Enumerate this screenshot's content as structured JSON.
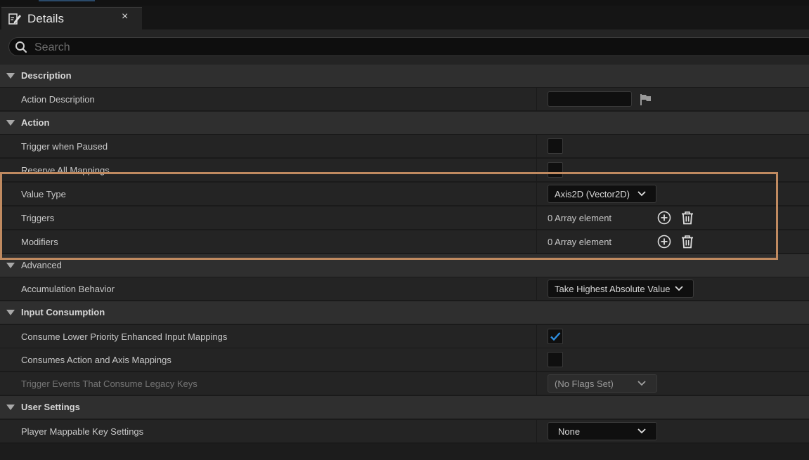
{
  "tab": {
    "title": "Details",
    "close": "×"
  },
  "search": {
    "placeholder": "Search",
    "value": ""
  },
  "sections": {
    "description": "Description",
    "action": "Action",
    "advanced": "Advanced",
    "input_consumption": "Input Consumption",
    "user_settings": "User Settings"
  },
  "props": {
    "action_description": {
      "label": "Action Description",
      "value": ""
    },
    "trigger_when_paused": {
      "label": "Trigger when Paused",
      "checked": false
    },
    "reserve_all_mappings": {
      "label": "Reserve All Mappings",
      "checked": false
    },
    "value_type": {
      "label": "Value Type",
      "value": "Axis2D (Vector2D)"
    },
    "triggers": {
      "label": "Triggers",
      "value": "0 Array element"
    },
    "modifiers": {
      "label": "Modifiers",
      "value": "0 Array element"
    },
    "accumulation_behavior": {
      "label": "Accumulation Behavior",
      "value": "Take Highest Absolute Value"
    },
    "consume_lower_priority": {
      "label": "Consume Lower Priority Enhanced Input Mappings",
      "checked": true
    },
    "consumes_action_axis": {
      "label": "Consumes Action and Axis Mappings",
      "checked": false
    },
    "trigger_events_legacy": {
      "label": "Trigger Events That Consume Legacy Keys",
      "value": "(No Flags Set)"
    },
    "player_mappable": {
      "label": "Player Mappable Key Settings",
      "value": "None"
    }
  },
  "colors": {
    "background": "#1a1a1a",
    "row": "#242424",
    "category": "#2f2f2f",
    "highlight": "#c08a60",
    "checkmark": "#2f8fe0"
  },
  "icons": [
    "edit-icon",
    "close-icon",
    "search-icon",
    "flag-icon",
    "plus-circle-icon",
    "trash-icon",
    "chevron-down-icon",
    "caret-down-icon",
    "checkmark-icon"
  ]
}
